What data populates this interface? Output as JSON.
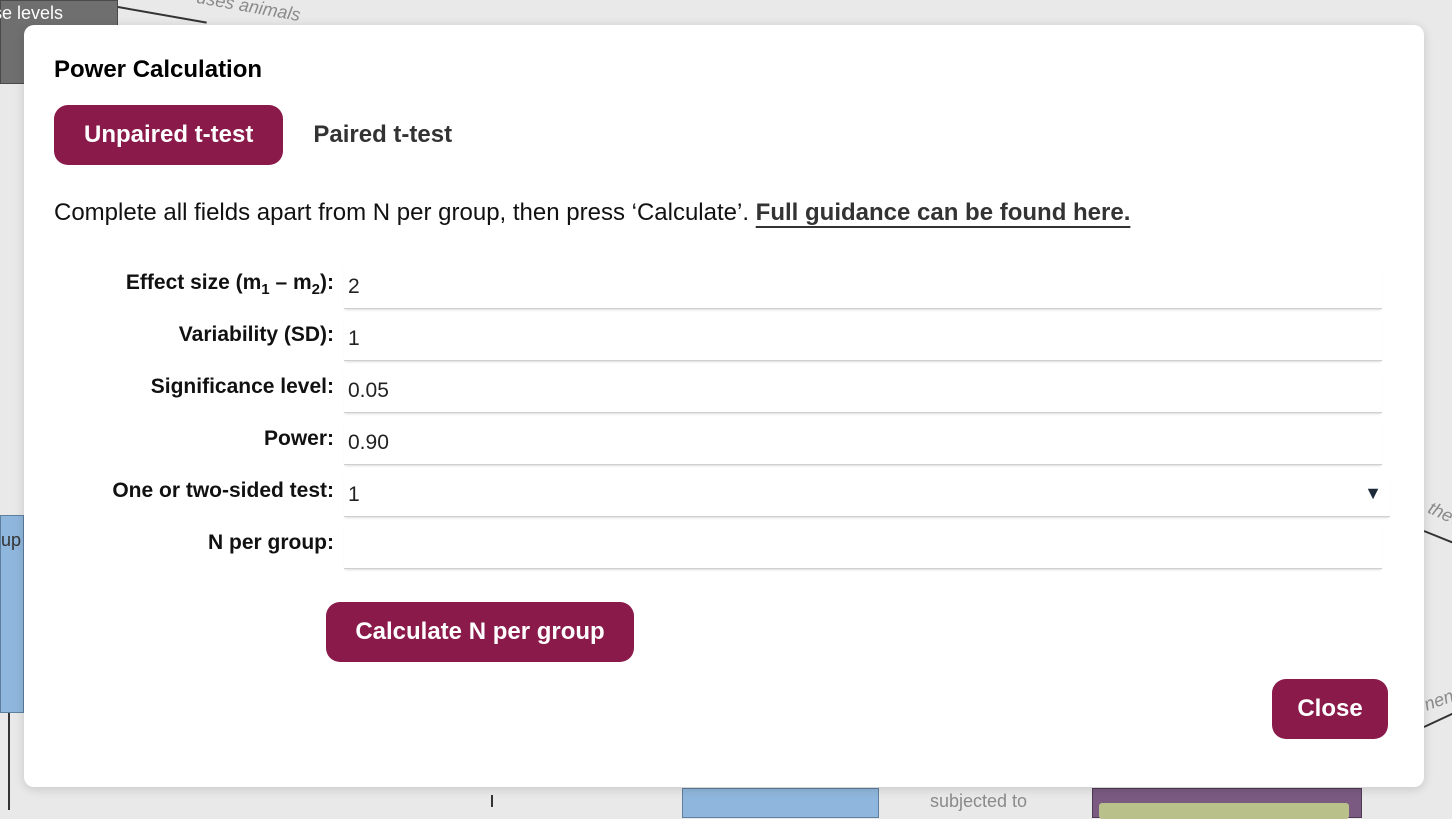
{
  "background": {
    "top_left_node": "se levels",
    "edge_label_top": "uses animals",
    "left_node": "up",
    "edge_label_right_1": "the",
    "edge_label_right_2": "nen",
    "bottom_label": "subjected to"
  },
  "modal": {
    "title": "Power Calculation",
    "tabs": [
      {
        "label": "Unpaired t-test",
        "active": true
      },
      {
        "label": "Paired t-test",
        "active": false
      }
    ],
    "instructions": {
      "text": "Complete all fields apart from N per group, then press ‘Calculate’.",
      "link": "Full guidance can be found here."
    },
    "fields": {
      "effect_size": {
        "label_pre": "Effect size (m",
        "sub1": "1",
        "label_mid": " – m",
        "sub2": "2",
        "label_post": "):",
        "value": "2"
      },
      "variability": {
        "label": "Variability (SD):",
        "value": "1"
      },
      "significance": {
        "label": "Significance level:",
        "value": "0.05"
      },
      "power": {
        "label": "Power:",
        "value": "0.90"
      },
      "sides": {
        "label": "One or two-sided test:",
        "value": "1"
      },
      "n_per_group": {
        "label": "N per group:",
        "value": ""
      }
    },
    "calculate_label": "Calculate N per group",
    "close_label": "Close"
  },
  "colors": {
    "accent": "#8a1a4a"
  }
}
